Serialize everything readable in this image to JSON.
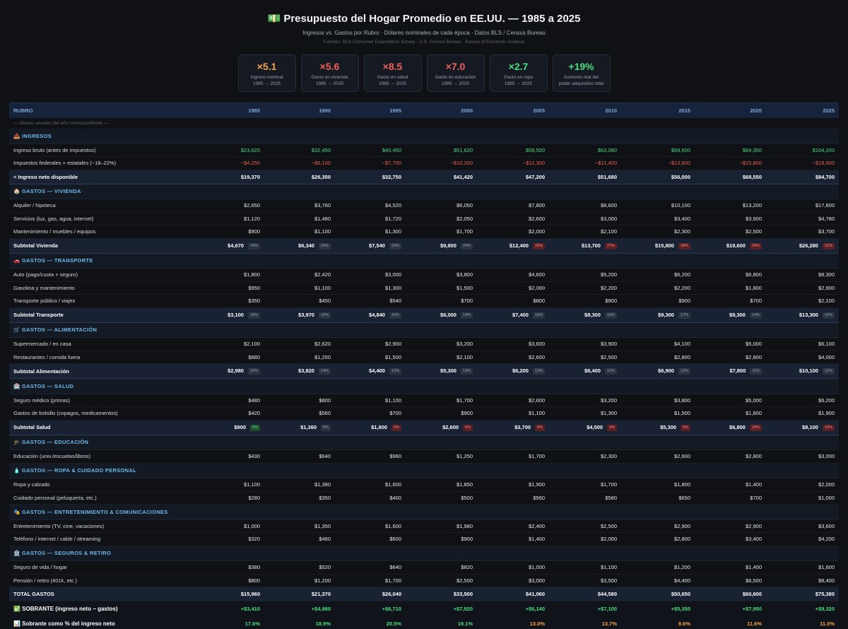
{
  "header": {
    "icon": "💵",
    "title": "Presupuesto del Hogar Promedio en EE.UU. — 1985 a 2025",
    "subtitle": "Ingresos vs. Gastos por Rubro · Dólares nominales de cada época · Datos BLS / Census Bureau",
    "sources": "Fuentes: BLS Consumer Expenditure Survey · U.S. Census Bureau · Bureau of Economic Analysis"
  },
  "cards": [
    {
      "value": "×5.1",
      "label": "Ingreso nominal\n1985 → 2025",
      "color": "#f5a34a"
    },
    {
      "value": "×5.6",
      "label": "Gasto en vivienda\n1985 → 2025",
      "color": "#f0605a"
    },
    {
      "value": "×8.5",
      "label": "Gasto en salud\n1985 → 2025",
      "color": "#f0605a"
    },
    {
      "value": "×7.0",
      "label": "Gasto en educación\n1985 → 2025",
      "color": "#f0605a"
    },
    {
      "value": "×2.7",
      "label": "Gasto en ropa\n1985 → 2025",
      "color": "#4ade80"
    },
    {
      "value": "+19%",
      "label": "Aumento real del\npoder adquisitivo total",
      "color": "#4ade80"
    }
  ],
  "table": {
    "header": [
      "RUBRO",
      "1985",
      "1990",
      "1995",
      "2000",
      "2005",
      "2010",
      "2015",
      "2020",
      "2025"
    ],
    "note": "— dólares anuales del año correspondiente —",
    "rows": [
      {
        "type": "sec",
        "label": "📥 INGRESOS"
      },
      {
        "type": "row",
        "label": "Ingreso bruto (antes de impuestos)",
        "cls": "pos",
        "values": [
          "$23,620",
          "$32,450",
          "$40,450",
          "$51,620",
          "$58,500",
          "$63,080",
          "$69,600",
          "$84,350",
          "$104,200"
        ]
      },
      {
        "type": "row",
        "label": "Impuestos federales + estatales (~18–22%)",
        "cls": "neg",
        "values": [
          "−$4,250",
          "−$6,100",
          "−$7,700",
          "−$10,200",
          "−$11,300",
          "−$11,400",
          "−$13,600",
          "−$15,800",
          "−$19,500"
        ]
      },
      {
        "type": "net",
        "label": "= Ingreso neto disponible",
        "values": [
          "$19,370",
          "$26,350",
          "$32,750",
          "$41,420",
          "$47,200",
          "$51,680",
          "$56,000",
          "$68,550",
          "$84,700"
        ]
      },
      {
        "type": "sec",
        "label": "🏠 GASTOS — VIVIENDA"
      },
      {
        "type": "row",
        "label": "Alquiler / hipoteca",
        "values": [
          "$2,650",
          "$3,760",
          "$4,520",
          "$6,050",
          "$7,800",
          "$8,600",
          "$10,100",
          "$13,200",
          "$17,800"
        ]
      },
      {
        "type": "row",
        "label": "Servicios (luz, gas, agua, internet)",
        "values": [
          "$1,120",
          "$1,480",
          "$1,720",
          "$2,050",
          "$2,600",
          "$3,000",
          "$3,400",
          "$3,900",
          "$4,780"
        ]
      },
      {
        "type": "row",
        "label": "Mantenimiento / muebles / equipos",
        "values": [
          "$900",
          "$1,100",
          "$1,300",
          "$1,700",
          "$2,000",
          "$2,100",
          "$2,300",
          "$2,500",
          "$3,700"
        ]
      },
      {
        "type": "sub",
        "label": "Subtotal Vivienda",
        "values": [
          "$4,670",
          "$6,340",
          "$7,540",
          "$9,800",
          "$12,400",
          "$13,700",
          "$15,800",
          "$19,600",
          "$26,280"
        ],
        "badges": [
          "24%",
          "24%",
          "23%",
          "24%",
          "26%",
          "27%",
          "28%",
          "29%",
          "31%"
        ],
        "badge_kinds": [
          "neu",
          "neu",
          "neu",
          "neu",
          "bad",
          "bad",
          "bad",
          "bad",
          "bad"
        ]
      },
      {
        "type": "sec",
        "label": "🚗 GASTOS — TRANSPORTE"
      },
      {
        "type": "row",
        "label": "Auto (pago/cuota + seguro)",
        "values": [
          "$1,800",
          "$2,420",
          "$3,000",
          "$3,800",
          "$4,600",
          "$5,200",
          "$6,200",
          "$6,800",
          "$8,300"
        ]
      },
      {
        "type": "row",
        "label": "Gasolina y mantenimiento",
        "values": [
          "$950",
          "$1,100",
          "$1,300",
          "$1,500",
          "$2,000",
          "$2,200",
          "$2,200",
          "$1,800",
          "$2,900"
        ]
      },
      {
        "type": "row",
        "label": "Transporte público / viajes",
        "values": [
          "$350",
          "$450",
          "$540",
          "$700",
          "$800",
          "$900",
          "$900",
          "$700",
          "$2,100"
        ]
      },
      {
        "type": "sub",
        "label": "Subtotal Transporte",
        "values": [
          "$3,100",
          "$3,970",
          "$4,840",
          "$6,000",
          "$7,400",
          "$8,300",
          "$9,300",
          "$9,300",
          "$13,300"
        ],
        "badges": [
          "16%",
          "15%",
          "15%",
          "14%",
          "16%",
          "16%",
          "17%",
          "14%",
          "16%"
        ],
        "badge_kinds": [
          "neu",
          "neu",
          "neu",
          "neu",
          "neu",
          "neu",
          "neu",
          "neu",
          "neu"
        ]
      },
      {
        "type": "sec",
        "label": "🛒 GASTOS — ALIMENTACIÓN"
      },
      {
        "type": "row",
        "label": "Supermercado / en casa",
        "values": [
          "$2,100",
          "$2,620",
          "$2,900",
          "$3,200",
          "$3,600",
          "$3,900",
          "$4,100",
          "$5,000",
          "$6,100"
        ]
      },
      {
        "type": "row",
        "label": "Restaurantes / comida fuera",
        "values": [
          "$880",
          "$1,200",
          "$1,500",
          "$2,100",
          "$2,600",
          "$2,500",
          "$2,800",
          "$2,800",
          "$4,000"
        ]
      },
      {
        "type": "sub",
        "label": "Subtotal Alimentación",
        "values": [
          "$2,980",
          "$3,820",
          "$4,400",
          "$5,300",
          "$6,200",
          "$6,400",
          "$6,900",
          "$7,800",
          "$10,100"
        ],
        "badges": [
          "15%",
          "14%",
          "13%",
          "13%",
          "13%",
          "12%",
          "12%",
          "11%",
          "12%"
        ],
        "badge_kinds": [
          "neu",
          "neu",
          "neu",
          "neu",
          "neu",
          "neu",
          "neu",
          "neu",
          "neu"
        ]
      },
      {
        "type": "sec",
        "label": "🏥 GASTOS — SALUD"
      },
      {
        "type": "row",
        "label": "Seguro médico (primas)",
        "values": [
          "$480",
          "$800",
          "$1,100",
          "$1,700",
          "$2,600",
          "$3,200",
          "$3,800",
          "$5,000",
          "$6,200"
        ]
      },
      {
        "type": "row",
        "label": "Gastos de bolsillo (copagos, medicamentos)",
        "values": [
          "$420",
          "$560",
          "$700",
          "$900",
          "$1,100",
          "$1,300",
          "$1,500",
          "$1,800",
          "$1,900"
        ]
      },
      {
        "type": "sub",
        "label": "Subtotal Salud",
        "values": [
          "$900",
          "$1,360",
          "$1,800",
          "$2,600",
          "$3,700",
          "$4,500",
          "$5,300",
          "$6,800",
          "$8,100"
        ],
        "badges": [
          "5%",
          "5%",
          "5%",
          "6%",
          "8%",
          "9%",
          "9%",
          "10%",
          "10%"
        ],
        "badge_kinds": [
          "good",
          "neu",
          "bad",
          "bad",
          "bad",
          "bad",
          "bad",
          "bad",
          "bad"
        ]
      },
      {
        "type": "sec",
        "label": "🎓 GASTOS — EDUCACIÓN"
      },
      {
        "type": "row",
        "label": "Educación (univ./escuelas/libros)",
        "values": [
          "$430",
          "$640",
          "$960",
          "$1,250",
          "$1,700",
          "$2,300",
          "$2,600",
          "$2,800",
          "$3,000"
        ]
      },
      {
        "type": "sec",
        "label": "🧴 GASTOS — ROPA & CUIDADO PERSONAL"
      },
      {
        "type": "row",
        "label": "Ropa y calzado",
        "values": [
          "$1,100",
          "$1,380",
          "$1,600",
          "$1,850",
          "$1,900",
          "$1,700",
          "$1,800",
          "$1,400",
          "$2,000"
        ]
      },
      {
        "type": "row",
        "label": "Cuidado personal (peluquería, etc.)",
        "values": [
          "$280",
          "$350",
          "$400",
          "$500",
          "$560",
          "$580",
          "$650",
          "$700",
          "$1,000"
        ]
      },
      {
        "type": "sec",
        "label": "🎭 GASTOS — ENTRETENIMIENTO & COMUNICACIONES"
      },
      {
        "type": "row",
        "label": "Entretenimiento (TV, cine, vacaciones)",
        "values": [
          "$1,000",
          "$1,350",
          "$1,600",
          "$1,980",
          "$2,400",
          "$2,500",
          "$2,900",
          "$2,900",
          "$3,600"
        ]
      },
      {
        "type": "row",
        "label": "Teléfono / internet / cable / streaming",
        "values": [
          "$320",
          "$460",
          "$600",
          "$900",
          "$1,400",
          "$2,000",
          "$2,800",
          "$3,400",
          "$4,200"
        ]
      },
      {
        "type": "sec",
        "label": "🏦 GASTOS — SEGUROS & RETIRO"
      },
      {
        "type": "row",
        "label": "Seguro de vida / hogar",
        "values": [
          "$380",
          "$520",
          "$640",
          "$820",
          "$1,000",
          "$1,100",
          "$1,200",
          "$1,400",
          "$1,600"
        ]
      },
      {
        "type": "row",
        "label": "Pensión / retiro (401k, etc.)",
        "values": [
          "$800",
          "$1,200",
          "$1,700",
          "$2,500",
          "$3,000",
          "$3,500",
          "$4,400",
          "$6,500",
          "$8,400"
        ]
      },
      {
        "type": "total",
        "label": "TOTAL GASTOS",
        "values": [
          "$15,960",
          "$21,370",
          "$26,040",
          "$33,500",
          "$41,060",
          "$44,580",
          "$50,650",
          "$60,600",
          "$75,380"
        ]
      },
      {
        "type": "surplus",
        "label": "✅ SOBRANTE (ingreso neto − gastos)",
        "values": [
          "+$3,410",
          "+$4,980",
          "+$6,710",
          "+$7,920",
          "+$6,140",
          "+$7,100",
          "+$5,350",
          "+$7,950",
          "+$9,320"
        ],
        "value_classes": [
          "pos",
          "pos",
          "pos",
          "pos",
          "pos",
          "pos",
          "pos",
          "pos",
          "pos"
        ]
      },
      {
        "type": "pct",
        "label": "📊 Sobrante como % del ingreso neto",
        "values": [
          "17.6%",
          "18.9%",
          "20.5%",
          "19.1%",
          "13.0%",
          "13.7%",
          "9.6%",
          "11.6%",
          "11.0%"
        ],
        "value_classes": [
          "pos",
          "pos",
          "pos",
          "pos",
          "warn",
          "warn",
          "warn",
          "warn",
          "warn"
        ]
      }
    ]
  }
}
